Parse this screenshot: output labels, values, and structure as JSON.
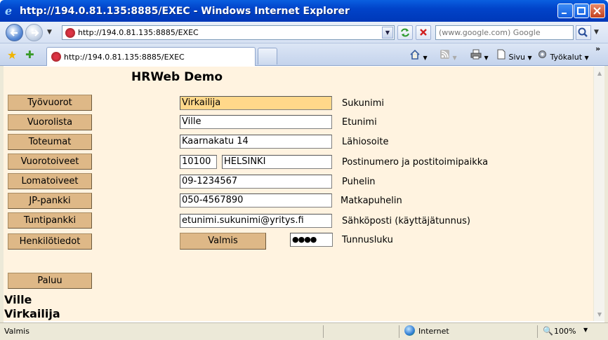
{
  "window": {
    "title": "http://194.0.81.135:8885/EXEC - Windows Internet Explorer"
  },
  "address_bar": {
    "url": "http://194.0.81.135:8885/EXEC",
    "search_placeholder": "(www.google.com) Google"
  },
  "tab": {
    "title": "http://194.0.81.135:8885/EXEC"
  },
  "toolbar": {
    "page_label": "Sivu",
    "tools_label": "Työkalut"
  },
  "page": {
    "title": "HRWeb Demo",
    "nav_buttons": [
      "Työvuorot",
      "Vuorolista",
      "Toteumat",
      "Vuorotoiveet",
      "Lomatoiveet",
      "JP-pankki",
      "Tuntipankki",
      "Henkilötiedot"
    ],
    "back_button": "Paluu",
    "form": {
      "surname": {
        "value": "Virkailija",
        "label": "Sukunimi"
      },
      "firstname": {
        "value": "Ville",
        "label": "Etunimi"
      },
      "address": {
        "value": "Kaarnakatu 14",
        "label": "Lähiosoite"
      },
      "postal_code": {
        "value": "10100"
      },
      "city": {
        "value": "HELSINKI",
        "label": "Postinumero ja postitoimipaikka"
      },
      "phone": {
        "value": "09-1234567",
        "label": "Puhelin"
      },
      "mobile": {
        "value": "050-4567890",
        "label": "Matkapuhelin"
      },
      "email": {
        "value": "etunimi.sukunimi@yritys.fi",
        "label": "Sähköposti (käyttäjätunnus)"
      },
      "password": {
        "value": "●●●●",
        "label": "Tunnusluku"
      },
      "submit_label": "Valmis"
    },
    "user": {
      "first": "Ville",
      "last": "Virkailija"
    }
  },
  "status_bar": {
    "status": "Valmis",
    "zone": "Internet",
    "zoom": "100%"
  }
}
